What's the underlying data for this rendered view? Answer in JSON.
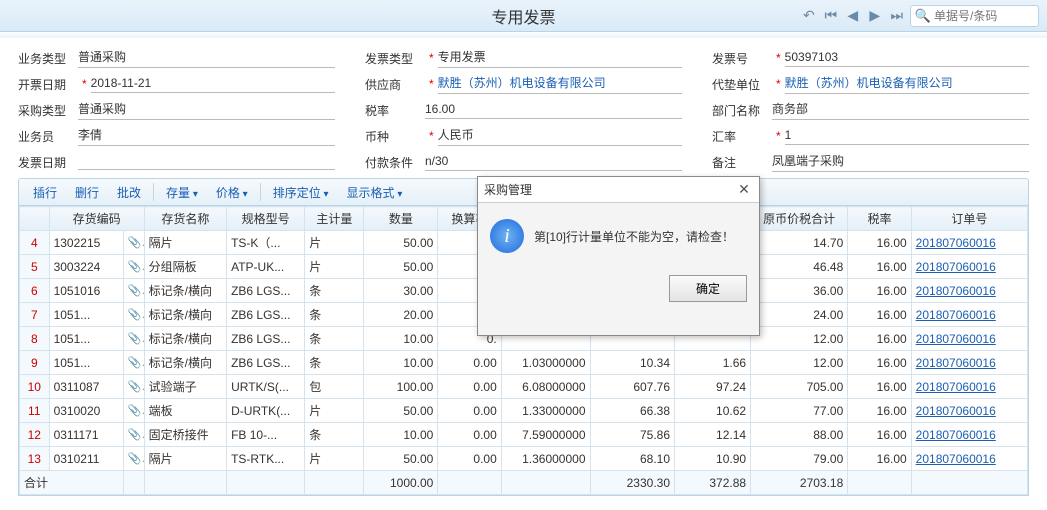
{
  "title": "专用发票",
  "search_placeholder": "单据号/条码",
  "form": {
    "left": {
      "biz_type_l": "业务类型",
      "biz_type_v": "普通采购",
      "bill_date_l": "开票日期",
      "bill_date_v": "2018-11-21",
      "purch_type_l": "采购类型",
      "purch_type_v": "普通采购",
      "clerk_l": "业务员",
      "clerk_v": "李倩",
      "inv_date_l": "发票日期",
      "inv_date_v": ""
    },
    "mid": {
      "inv_type_l": "发票类型",
      "inv_type_v": "专用发票",
      "supplier_l": "供应商",
      "supplier_v": "默胜（苏州）机电设备有限公司",
      "tax_l": "税率",
      "tax_v": "16.00",
      "currency_l": "币种",
      "currency_v": "人民币",
      "pay_l": "付款条件",
      "pay_v": "n/30"
    },
    "right": {
      "inv_no_l": "发票号",
      "inv_no_v": "50397103",
      "adv_unit_l": "代垫单位",
      "adv_unit_v": "默胜（苏州）机电设备有限公司",
      "dept_l": "部门名称",
      "dept_v": "商务部",
      "rate_l": "汇率",
      "rate_v": "1",
      "note_l": "备注",
      "note_v": "凤凰端子采购"
    }
  },
  "toolbar": {
    "ins": "插行",
    "del": "删行",
    "batch": "批改",
    "stock": "存量",
    "price": "价格",
    "sort": "排序定位",
    "display": "显示格式"
  },
  "cols": {
    "c0": "",
    "code": "存货编码",
    "name": "存货名称",
    "spec": "规格型号",
    "unit": "主计量",
    "qty": "数量",
    "conv": "换算率",
    "c7": "",
    "c8": "",
    "c9": "",
    "amt": "原币价税合计",
    "tax": "税率",
    "order": "订单号"
  },
  "rows": [
    {
      "idx": "4",
      "code": "1302215",
      "name": "隔片",
      "spec": "TS-K（...",
      "unit": "片",
      "qty": "50.00",
      "conv": "0.",
      "amt": "14.70",
      "tax": "16.00",
      "order": "201807060016"
    },
    {
      "idx": "5",
      "code": "3003224",
      "name": "分组隔板",
      "spec": "ATP-UK...",
      "unit": "片",
      "qty": "50.00",
      "conv": "0.",
      "amt": "46.48",
      "tax": "16.00",
      "order": "201807060016"
    },
    {
      "idx": "6",
      "code": "1051016",
      "name": "标记条/横向",
      "spec": "ZB6 LGS...",
      "unit": "条",
      "qty": "30.00",
      "conv": "0.",
      "amt": "36.00",
      "tax": "16.00",
      "order": "201807060016"
    },
    {
      "idx": "7",
      "code": "1051...",
      "name": "标记条/横向",
      "spec": "ZB6 LGS...",
      "unit": "条",
      "qty": "20.00",
      "conv": "0.",
      "amt": "24.00",
      "tax": "16.00",
      "order": "201807060016"
    },
    {
      "idx": "8",
      "code": "1051...",
      "name": "标记条/横向",
      "spec": "ZB6 LGS...",
      "unit": "条",
      "qty": "10.00",
      "conv": "0.",
      "amt": "12.00",
      "tax": "16.00",
      "order": "201807060016"
    },
    {
      "idx": "9",
      "code": "1051...",
      "name": "标记条/横向",
      "spec": "ZB6 LGS...",
      "unit": "条",
      "qty": "10.00",
      "conv": "0.00",
      "r": "1.03000000",
      "a": "10.34",
      "b": "1.66",
      "amt": "12.00",
      "tax": "16.00",
      "order": "201807060016"
    },
    {
      "idx": "10",
      "code": "0311087",
      "name": "试验端子",
      "spec": "URTK/S(...",
      "unit": "包",
      "qty": "100.00",
      "conv": "0.00",
      "r": "6.08000000",
      "a": "607.76",
      "b": "97.24",
      "amt": "705.00",
      "tax": "16.00",
      "order": "201807060016"
    },
    {
      "idx": "11",
      "code": "0310020",
      "name": "端板",
      "spec": "D-URTK(...",
      "unit": "片",
      "qty": "50.00",
      "conv": "0.00",
      "r": "1.33000000",
      "a": "66.38",
      "b": "10.62",
      "amt": "77.00",
      "tax": "16.00",
      "order": "201807060016"
    },
    {
      "idx": "12",
      "code": "0311171",
      "name": "固定桥接件",
      "spec": "FB  10-...",
      "unit": "条",
      "qty": "10.00",
      "conv": "0.00",
      "r": "7.59000000",
      "a": "75.86",
      "b": "12.14",
      "amt": "88.00",
      "tax": "16.00",
      "order": "201807060016"
    },
    {
      "idx": "13",
      "code": "0310211",
      "name": "隔片",
      "spec": "TS-RTK...",
      "unit": "片",
      "qty": "50.00",
      "conv": "0.00",
      "r": "1.36000000",
      "a": "68.10",
      "b": "10.90",
      "amt": "79.00",
      "tax": "16.00",
      "order": "201807060016"
    }
  ],
  "footer": {
    "label": "合计",
    "qty": "1000.00",
    "a": "2330.30",
    "b": "372.88",
    "amt": "2703.18"
  },
  "dialog": {
    "title": "采购管理",
    "msg": "第[10]行计量单位不能为空，请检查！",
    "ok": "确定"
  }
}
